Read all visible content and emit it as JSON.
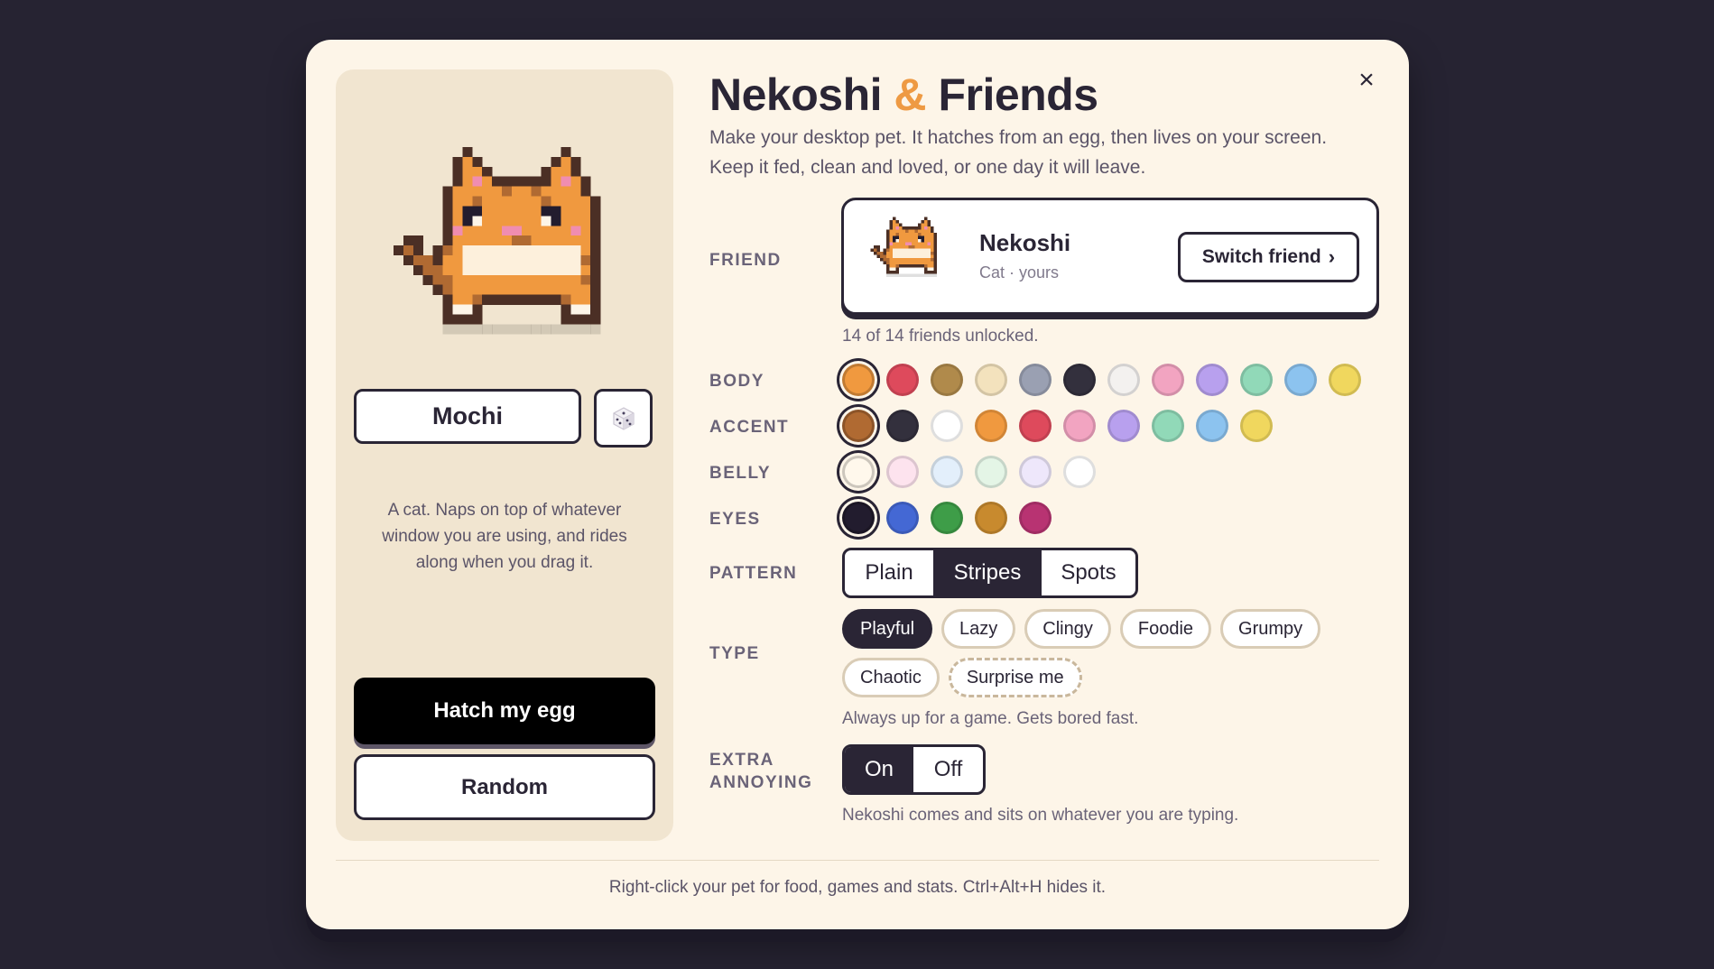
{
  "window": {
    "close_label": "×"
  },
  "title": {
    "part1": "Nekoshi",
    "amp": "&",
    "part2": "Friends"
  },
  "subtitle": "Make your desktop pet. It hatches from an egg, then lives on your screen. Keep it fed, clean and loved, or one day it will leave.",
  "left": {
    "pet_name": "Mochi",
    "dice_icon": "dice-icon",
    "description": "A cat. Naps on top of whatever window you are using, and rides along when you drag it.",
    "hatch_label": "Hatch my egg",
    "random_label": "Random"
  },
  "friend": {
    "label": "FRIEND",
    "name": "Nekoshi",
    "sub": "Cat · yours",
    "switch_label": "Switch friend",
    "switch_chevron": "›",
    "unlocked": "14 of 14 friends unlocked."
  },
  "colors": {
    "body": {
      "label": "BODY",
      "selected": 0,
      "swatches": [
        "#f0993f",
        "#de4a5c",
        "#b08a4b",
        "#f3e2bd",
        "#9aa0b2",
        "#33303d",
        "#f3f1ef",
        "#f2a4c1",
        "#b8a0ee",
        "#91d9b8",
        "#8cc3ef",
        "#f0d75e"
      ]
    },
    "accent": {
      "label": "ACCENT",
      "selected": 0,
      "swatches": [
        "#b06a32",
        "#33303d",
        "#ffffff",
        "#f0993f",
        "#de4a5c",
        "#f2a4c1",
        "#b8a0ee",
        "#91d9b8",
        "#8cc3ef",
        "#f0d75e"
      ]
    },
    "belly": {
      "label": "BELLY",
      "selected": 0,
      "swatches": [
        "#fff8ec",
        "#fde3ee",
        "#e3effb",
        "#e4f5e6",
        "#eee7fb",
        "#ffffff"
      ]
    },
    "eyes": {
      "label": "EYES",
      "selected": 0,
      "swatches": [
        "#221c2e",
        "#4468d4",
        "#3e9d48",
        "#c88a2e",
        "#b83372"
      ]
    }
  },
  "pattern": {
    "label": "PATTERN",
    "options": [
      "Plain",
      "Stripes",
      "Spots"
    ],
    "active": 1
  },
  "type": {
    "label": "TYPE",
    "options": [
      "Playful",
      "Lazy",
      "Clingy",
      "Foodie",
      "Grumpy",
      "Chaotic"
    ],
    "surprise": "Surprise me",
    "active": 0,
    "hint": "Always up for a game. Gets bored fast."
  },
  "extra": {
    "label_line1": "EXTRA",
    "label_line2": "ANNOYING",
    "on_label": "On",
    "off_label": "Off",
    "active": "on",
    "hint": "Nekoshi comes and sits on whatever you are typing."
  },
  "footer": "Right-click your pet for food, games and stats. Ctrl+Alt+H hides it."
}
